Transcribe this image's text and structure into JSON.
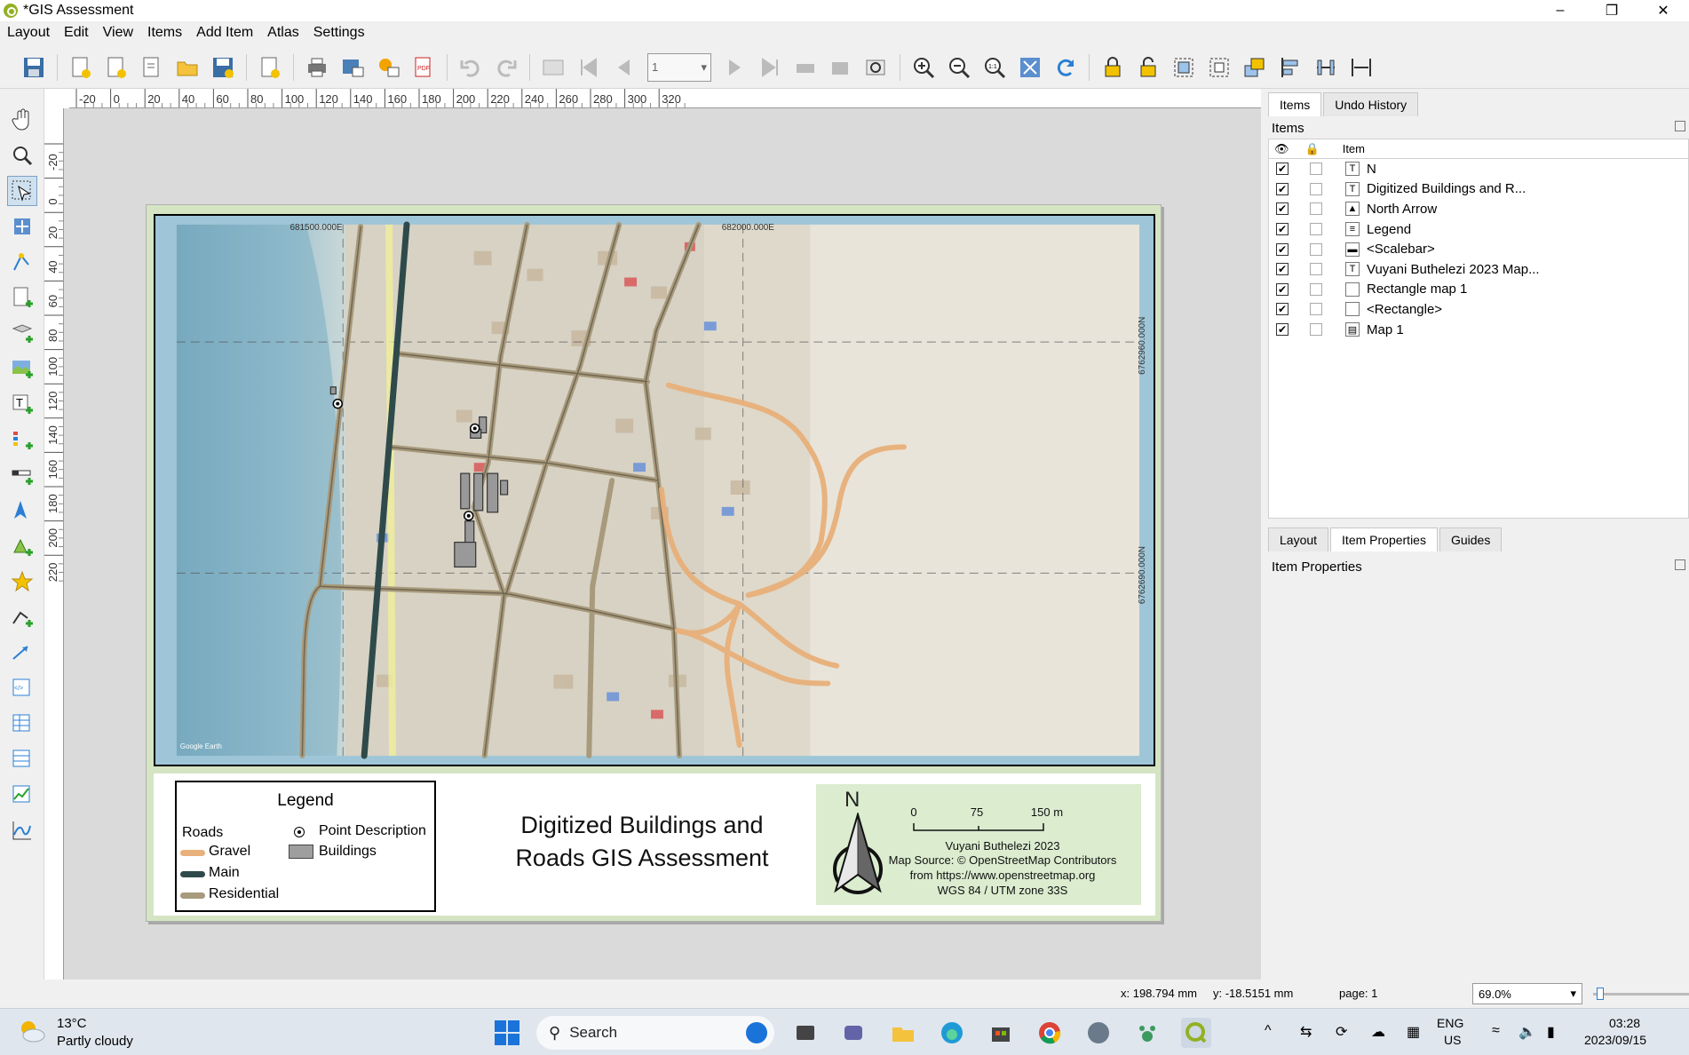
{
  "window": {
    "title": "*GIS Assessment"
  },
  "menu": [
    "Layout",
    "Edit",
    "View",
    "Items",
    "Add Item",
    "Atlas",
    "Settings"
  ],
  "toolbar": {
    "page_number": "1"
  },
  "rulers": {
    "h_ticks": [
      "-20",
      "0",
      "20",
      "40",
      "60",
      "80",
      "100",
      "120",
      "140",
      "160",
      "180",
      "200",
      "220",
      "240",
      "260",
      "280",
      "300",
      "320"
    ],
    "v_ticks": [
      "-20",
      "0",
      "20",
      "40",
      "60",
      "80",
      "100",
      "120",
      "140",
      "160",
      "180",
      "200",
      "220"
    ]
  },
  "map": {
    "coord_top_left": "681500.000E",
    "coord_top_right": "682000.000E",
    "coord_right_top": "6762960.000N",
    "coord_right_bottom": "6762690.000N",
    "attribution": "Google Earth"
  },
  "legend": {
    "title": "Legend",
    "group": "Roads",
    "items": [
      {
        "label": "Gravel",
        "color": "#e8b07a"
      },
      {
        "label": "Main",
        "color": "#2f4a4a"
      },
      {
        "label": "Residential",
        "color": "#a89a7c"
      }
    ],
    "point_label": "Point Description",
    "buildings_label": "Buildings"
  },
  "layout_title": {
    "line1": "Digitized Buildings and",
    "line2": "Roads GIS Assessment"
  },
  "north_arrow": {
    "letter": "N"
  },
  "scalebar": {
    "labels": [
      "0",
      "75",
      "150 m"
    ]
  },
  "credits": {
    "author": "Vuyani Buthelezi 2023",
    "source": "Map Source: © OpenStreetMap Contributors",
    "url": "from https://www.openstreetmap.org",
    "crs": "WGS 84 / UTM zone 33S"
  },
  "right_panel": {
    "tabs": [
      "Items",
      "Undo History"
    ],
    "items_title": "Items",
    "column_item": "Item",
    "items": [
      {
        "name": "N",
        "icon": "T"
      },
      {
        "name": "Digitized Buildings and R...",
        "icon": "T"
      },
      {
        "name": "North Arrow",
        "icon": "pic"
      },
      {
        "name": "Legend",
        "icon": "leg"
      },
      {
        "name": "<Scalebar>",
        "icon": "sb"
      },
      {
        "name": "Vuyani Buthelezi 2023 Map...",
        "icon": "T"
      },
      {
        "name": "Rectangle map 1",
        "icon": "rect"
      },
      {
        "name": "<Rectangle>",
        "icon": "rect"
      },
      {
        "name": "Map 1",
        "icon": "map"
      }
    ],
    "bottom_tabs": [
      "Layout",
      "Item Properties",
      "Guides"
    ],
    "props_title": "Item Properties"
  },
  "status": {
    "x": "x: 198.794 mm",
    "y": "y: -18.5151 mm",
    "page": "page: 1",
    "zoom": "69.0%"
  },
  "taskbar": {
    "weather_temp": "13°C",
    "weather_desc": "Partly cloudy",
    "search_placeholder": "Search",
    "lang": "ENG",
    "region": "US",
    "time": "03:28",
    "date": "2023/09/15"
  }
}
